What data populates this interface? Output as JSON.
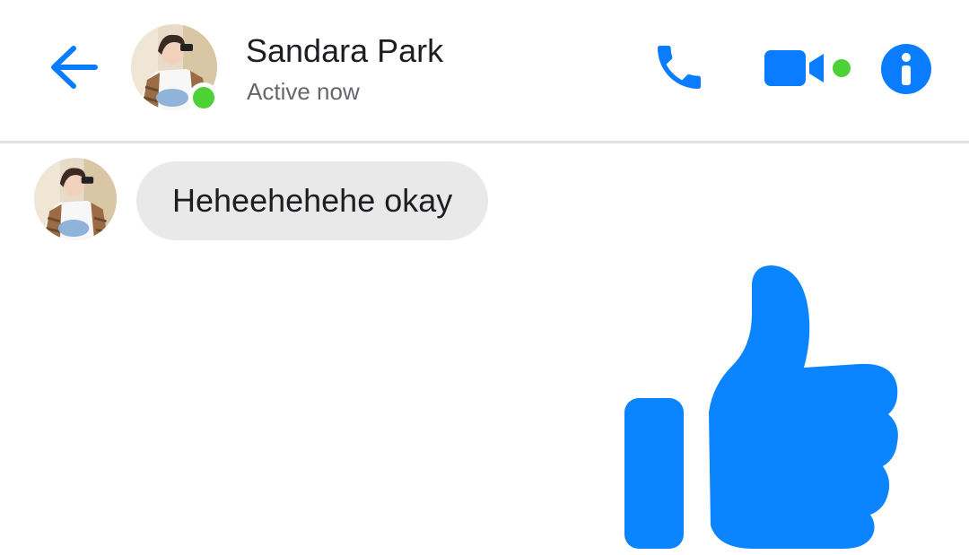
{
  "header": {
    "contact_name": "Sandara Park",
    "status": "Active now",
    "online": true,
    "video_call_active": true
  },
  "messages": [
    {
      "sender": "contact",
      "text": "Heheehehehe okay"
    },
    {
      "sender": "me",
      "type": "sticker",
      "sticker": "thumbs-up-icon"
    }
  ],
  "icons": {
    "back": "arrow-left-icon",
    "call": "phone-icon",
    "video": "video-camera-icon",
    "info": "info-icon"
  },
  "colors": {
    "accent": "#0a7cff",
    "online": "#4cd137",
    "bubble_incoming": "#e9e9e9",
    "text_primary": "#1c1e21",
    "text_secondary": "#65676b"
  }
}
